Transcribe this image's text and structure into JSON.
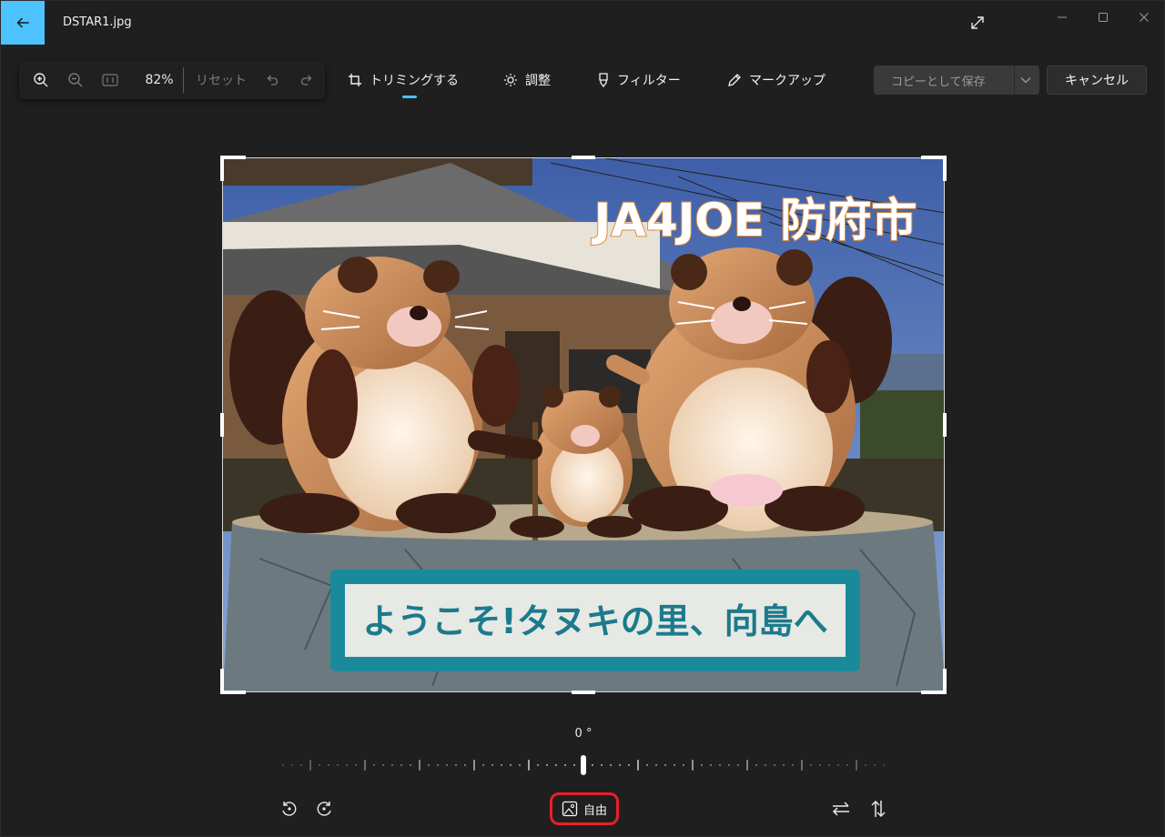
{
  "window": {
    "title": "DSTAR1.jpg"
  },
  "zoom": {
    "level": "82%",
    "reset_label": "リセット"
  },
  "tabs": [
    {
      "label": "トリミングする",
      "active": true
    },
    {
      "label": "調整",
      "active": false
    },
    {
      "label": "フィルター",
      "active": false
    },
    {
      "label": "マークアップ",
      "active": false
    }
  ],
  "actions": {
    "save_label": "コピーとして保存",
    "cancel_label": "キャンセル"
  },
  "photo": {
    "overlay_title": "JA4JOE 防府市",
    "sign_text": "ようこそ!タヌキの里、向島へ"
  },
  "rotation": {
    "angle_label": "0 °",
    "angle_value": 0
  },
  "aspect": {
    "label": "自由"
  },
  "colors": {
    "accent": "#4cc2ff",
    "highlight": "#e8202a"
  }
}
